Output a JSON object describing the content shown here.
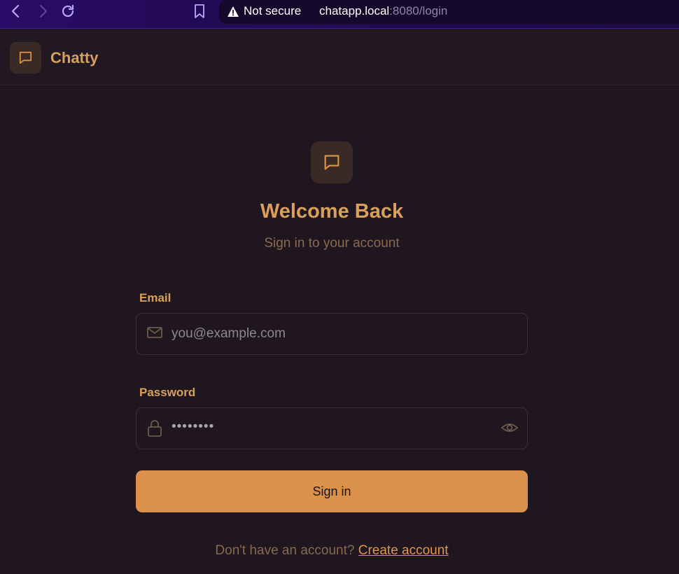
{
  "browser": {
    "security_label": "Not secure",
    "url_host": "chatapp.local",
    "url_path": ":8080/login",
    "icons": [
      "back-arrow-icon",
      "forward-arrow-icon",
      "reload-icon",
      "bookmark-icon",
      "warning-icon"
    ]
  },
  "app": {
    "brand": "Chatty",
    "accent_color": "#d9a05b",
    "button_color": "#db914b",
    "background_color": "#1f161f"
  },
  "login": {
    "title": "Welcome Back",
    "subtitle": "Sign in to your account",
    "email": {
      "label": "Email",
      "placeholder": "you@example.com",
      "value": ""
    },
    "password": {
      "label": "Password",
      "masked_value": "••••••••"
    },
    "submit_label": "Sign in",
    "footer_text": "Don't have an account?",
    "footer_link": "Create account"
  }
}
